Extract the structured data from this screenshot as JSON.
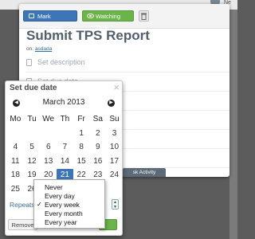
{
  "background": {
    "user_initial": "Ne"
  },
  "task": {
    "complete_label": "Mark Complete",
    "watching_label": "Watching Task",
    "title": "Submit TPS Report",
    "on_label": "on:",
    "project_link": "asdada",
    "fields": [
      "Set description",
      "Set due date"
    ],
    "activity_tab": "sk Activity"
  },
  "date_popup": {
    "title": "Set due date",
    "close_glyph": "×",
    "month_label": "March 2013",
    "weekdays": [
      "Mo",
      "Tu",
      "We",
      "Th",
      "Fr",
      "Sa",
      "Su"
    ],
    "weeks": [
      [
        "",
        "",
        "",
        "",
        "1",
        "2",
        "3"
      ],
      [
        "4",
        "5",
        "6",
        "7",
        "8",
        "9",
        "10"
      ],
      [
        "11",
        "12",
        "13",
        "14",
        "15",
        "16",
        "17"
      ],
      [
        "18",
        "19",
        "20",
        "21",
        "22",
        "23",
        "24"
      ],
      [
        "25",
        "26",
        "",
        "",
        "",
        "",
        ""
      ]
    ],
    "selected_day": "21",
    "repeats_label": "Repeats",
    "remove_label": "Remove"
  },
  "repeat_menu": {
    "options": [
      "Never",
      "Every day",
      "Every week",
      "Every month",
      "Every year"
    ],
    "selected": "Every week"
  },
  "colors": {
    "accent_blue": "#3d76b8",
    "accent_green": "#6bb44a",
    "title": "#515e6c"
  }
}
